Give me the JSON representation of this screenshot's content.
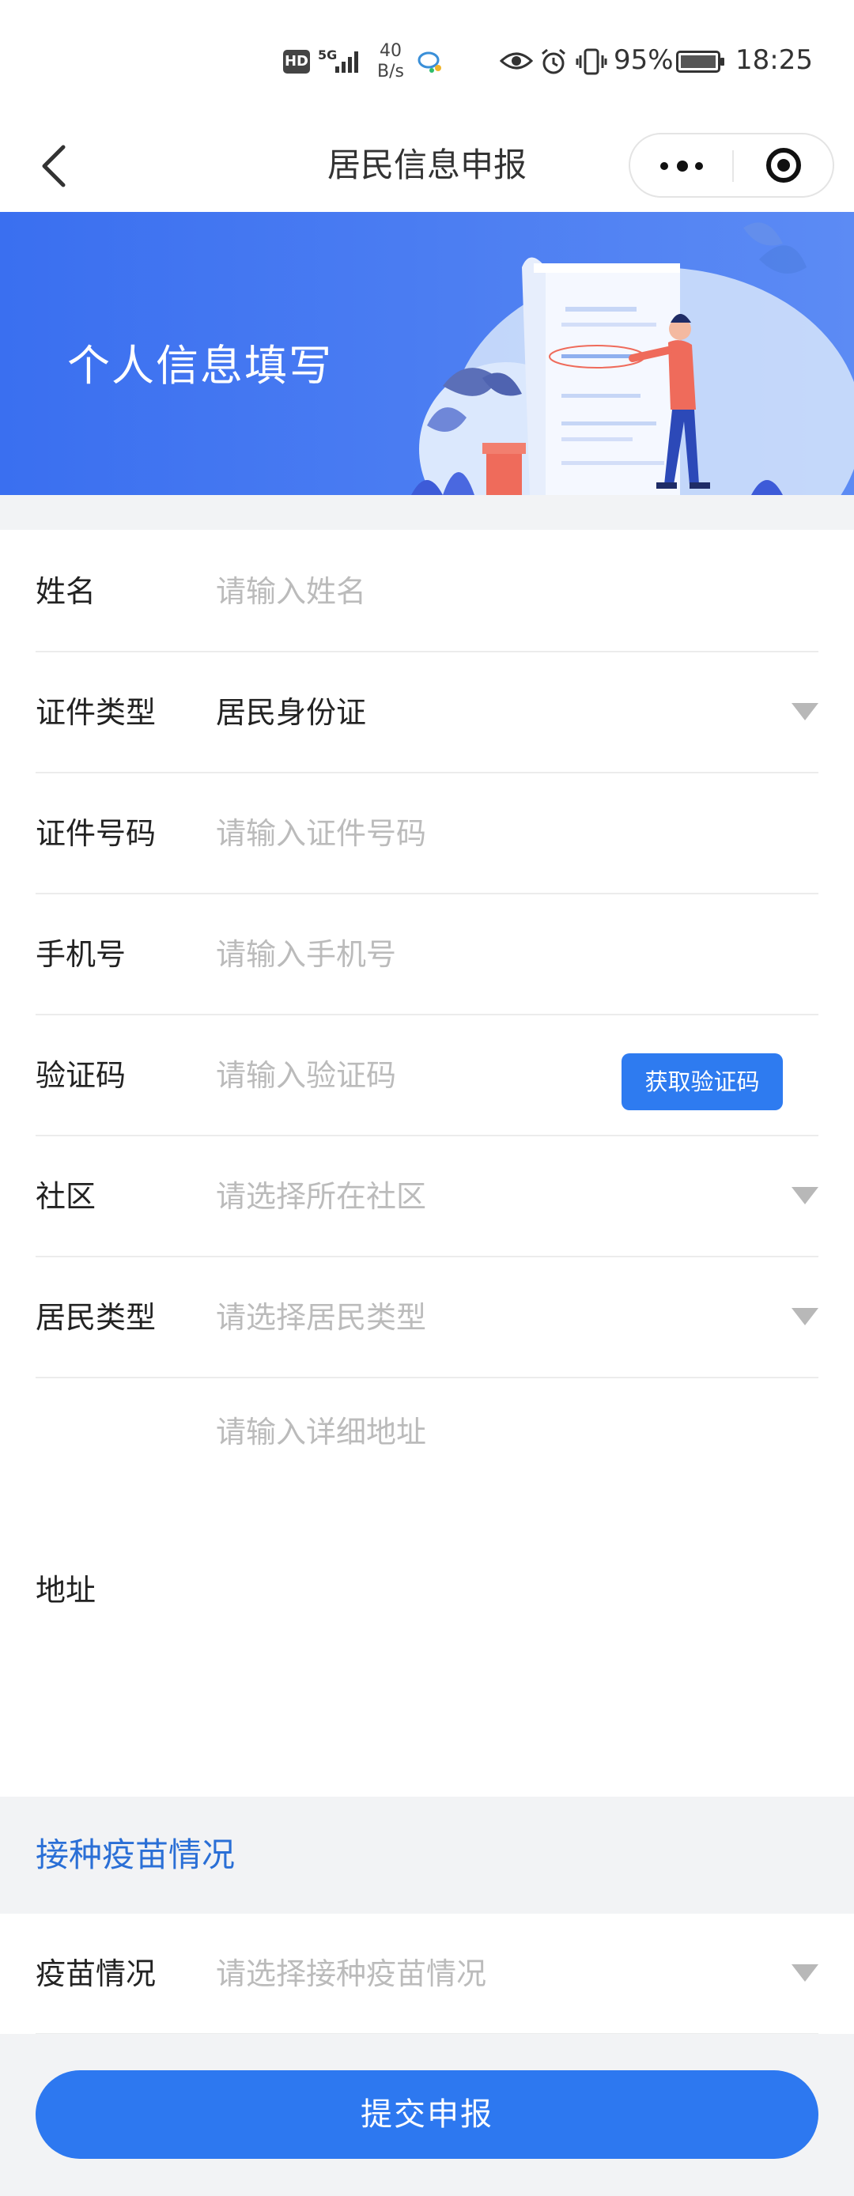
{
  "status_bar": {
    "hd": "HD",
    "network": "5G",
    "speed_value": "40",
    "speed_unit": "B/s",
    "battery": "95%",
    "time": "18:25"
  },
  "nav": {
    "title": "居民信息申报"
  },
  "banner": {
    "title": "个人信息填写"
  },
  "form": {
    "name": {
      "label": "姓名",
      "placeholder": "请输入姓名"
    },
    "id_type": {
      "label": "证件类型",
      "value": "居民身份证"
    },
    "id_number": {
      "label": "证件号码",
      "placeholder": "请输入证件号码"
    },
    "phone": {
      "label": "手机号",
      "placeholder": "请输入手机号"
    },
    "code": {
      "label": "验证码",
      "placeholder": "请输入验证码",
      "button": "获取验证码"
    },
    "community": {
      "label": "社区",
      "placeholder": "请选择所在社区"
    },
    "resident_type": {
      "label": "居民类型",
      "placeholder": "请选择居民类型"
    },
    "address": {
      "label": "地址",
      "placeholder": "请输入详细地址"
    }
  },
  "vaccine_section": {
    "title": "接种疫苗情况",
    "field": {
      "label": "疫苗情况",
      "placeholder": "请选择接种疫苗情况"
    }
  },
  "submit": {
    "label": "提交申报"
  },
  "colors": {
    "primary": "#2d78f0",
    "section_title": "#2a6fd6",
    "placeholder": "#bbbbbb"
  }
}
